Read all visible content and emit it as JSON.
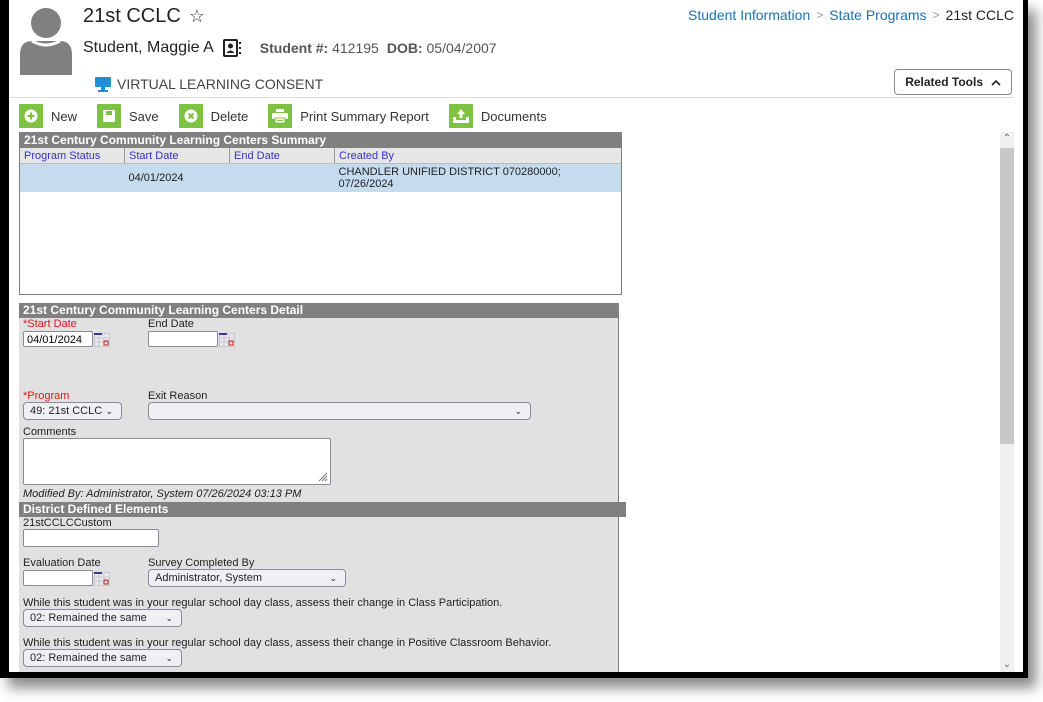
{
  "header": {
    "title": "21st CCLC",
    "favorite_icon": "star-outline-icon",
    "student_name": "Student, Maggie A",
    "student_number_label": "Student #:",
    "student_number": "412195",
    "dob_label": "DOB:",
    "dob": "05/04/2007",
    "virtual_learning": "VIRTUAL LEARNING CONSENT",
    "related_tools_label": "Related Tools"
  },
  "breadcrumb": [
    {
      "label": "Student Information"
    },
    {
      "label": "State Programs"
    },
    {
      "label": "21st CCLC"
    }
  ],
  "toolbar": {
    "new_label": "New",
    "save_label": "Save",
    "delete_label": "Delete",
    "print_label": "Print Summary Report",
    "documents_label": "Documents"
  },
  "summary": {
    "title": "21st Century Community Learning Centers Summary",
    "columns": [
      "Program Status",
      "Start Date",
      "End Date",
      "Created By"
    ],
    "rows": [
      {
        "program_status": "",
        "start_date": "04/01/2024",
        "end_date": "",
        "created_by": "CHANDLER UNIFIED DISTRICT 070280000; 07/26/2024"
      }
    ]
  },
  "detail": {
    "title": "21st Century Community Learning Centers Detail",
    "start_date_label": "*Start Date",
    "start_date_value": "04/01/2024",
    "end_date_label": "End Date",
    "end_date_value": "",
    "program_label": "*Program",
    "program_value": "49: 21st CCLC",
    "exit_reason_label": "Exit Reason",
    "exit_reason_value": "",
    "comments_label": "Comments",
    "comments_value": "",
    "modified_by": "Modified By: Administrator, System 07/26/2024 03:13 PM"
  },
  "district_elements": {
    "title": "District Defined Elements",
    "custom_label": "21stCCLCCustom",
    "custom_value": "",
    "evaluation_date_label": "Evaluation Date",
    "evaluation_date_value": "",
    "survey_label": "Survey Completed By",
    "survey_value": "Administrator, System",
    "q1_label": "While this student was in your regular school day class, assess their change in Class Participation.",
    "q1_value": "02: Remained the same",
    "q2_label": "While this student was in your regular school day class, assess their change in Positive Classroom Behavior.",
    "q2_value": "02: Remained the same"
  },
  "colors": {
    "accent_green": "#7dc242",
    "link_blue": "#1f6fb2",
    "panel_header": "#808080",
    "required_red": "#e0141e",
    "selected_row": "#c5dbee"
  }
}
